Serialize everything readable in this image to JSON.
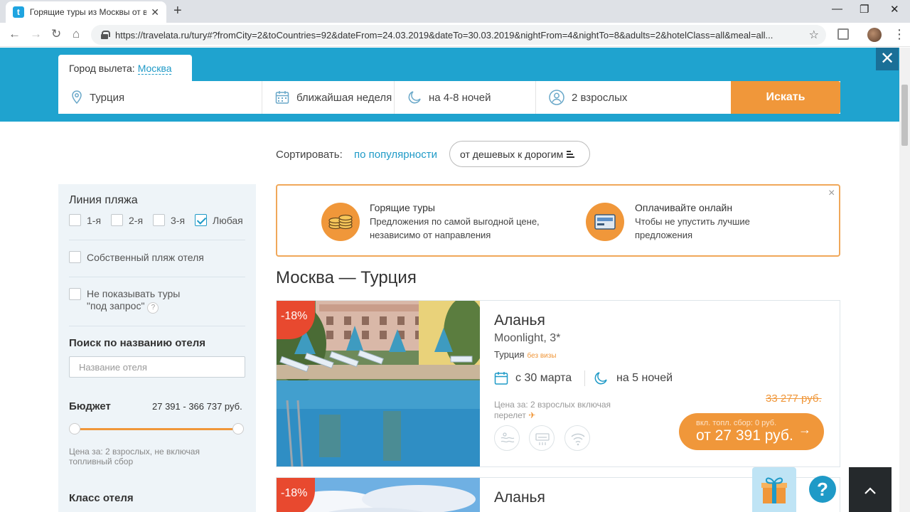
{
  "browser": {
    "tab_title": "Горящие туры из Москвы от вс",
    "tab_favicon": "t",
    "url": "https://travelata.ru/tury#?fromCity=2&toCountries=92&dateFrom=24.03.2019&dateTo=30.03.2019&nightFrom=4&nightTo=8&adults=2&hotelClass=all&meal=all..."
  },
  "search": {
    "city_label": "Город вылета:",
    "city_value": "Москва",
    "destination": "Турция",
    "dates": "ближайшая неделя",
    "nights": "на 4-8 ночей",
    "tourists": "2 взрослых",
    "button": "Искать"
  },
  "sort": {
    "label": "Сортировать:",
    "popular": "по популярности",
    "cheap": "от дешевых к дорогим"
  },
  "filters": {
    "beach_line_title": "Линия пляжа",
    "beach_lines": [
      {
        "label": "1-я",
        "checked": false
      },
      {
        "label": "2-я",
        "checked": false
      },
      {
        "label": "3-я",
        "checked": false
      },
      {
        "label": "Любая",
        "checked": true
      }
    ],
    "own_beach": "Собственный пляж отеля",
    "hide_on_request_1": "Не показывать туры",
    "hide_on_request_2": "\"под запрос\"",
    "hint": "?",
    "hotel_search_title": "Поиск по названию отеля",
    "hotel_search_placeholder": "Название отеля",
    "budget_title": "Бюджет",
    "budget_range": "27 391 - 366 737 руб.",
    "budget_note": "Цена за: 2 взрослых, не включая топливный сбор",
    "hotel_class_title": "Класс отеля"
  },
  "promo": {
    "item1_title": "Горящие туры",
    "item1_text": "Предложения по самой выгодной цене, независимо от направления",
    "item2_title": "Оплачивайте онлайн",
    "item2_text": "Чтобы не упустить лучшие предложения",
    "close": "×"
  },
  "section_title": "Москва — Турция",
  "hotels": [
    {
      "discount": "-18%",
      "city": "Аланья",
      "name": "Moonlight, 3*",
      "country": "Турция",
      "visa": "без визы",
      "date": "с 30 марта",
      "nights": "на 5 ночей",
      "price_note_1": "Цена за: 2 взрослых включая",
      "price_note_2": "перелет",
      "old_price": "33 277 руб.",
      "fee": "вкл. топл. сбор: 0 руб.",
      "price": "от 27 391 руб."
    },
    {
      "discount": "-18%",
      "city": "Аланья"
    }
  ],
  "colors": {
    "brand_blue": "#1fa3cf",
    "accent_orange": "#f0973a",
    "discount_red": "#e8492f"
  }
}
